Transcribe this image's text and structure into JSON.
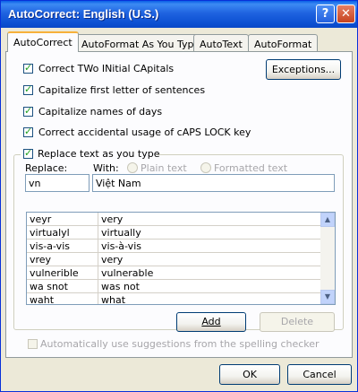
{
  "window": {
    "title": "AutoCorrect: English (U.S.)",
    "help_label": "?",
    "close_label": "✕"
  },
  "tabs": [
    "AutoCorrect",
    "AutoFormat As You Type",
    "AutoText",
    "AutoFormat"
  ],
  "options": {
    "correct_two_initials": "Correct TWo INitial CApitals",
    "capitalize_sentences": "Capitalize first letter of sentences",
    "capitalize_days": "Capitalize names of days",
    "caps_lock": "Correct accidental usage of cAPS LOCK key"
  },
  "exceptions_label": "Exceptions...",
  "replace_group": {
    "title": "Replace text as you type",
    "replace_label": "Replace:",
    "with_label": "With:",
    "plain_text": "Plain text",
    "formatted_text": "Formatted text",
    "replace_value": "vn",
    "with_value": "Việt Nam"
  },
  "entries": [
    {
      "replace": "veyr",
      "with": "very"
    },
    {
      "replace": "virtualyl",
      "with": "virtually"
    },
    {
      "replace": "vis-a-vis",
      "with": "vis-à-vis"
    },
    {
      "replace": "vrey",
      "with": "very"
    },
    {
      "replace": "vulnerible",
      "with": "vulnerable"
    },
    {
      "replace": "wa snot",
      "with": "was not"
    },
    {
      "replace": "waht",
      "with": "what"
    }
  ],
  "add_label": "Add",
  "delete_label": "Delete",
  "spelling_suggestions": "Automatically use suggestions from the spelling checker",
  "ok_label": "OK",
  "cancel_label": "Cancel"
}
